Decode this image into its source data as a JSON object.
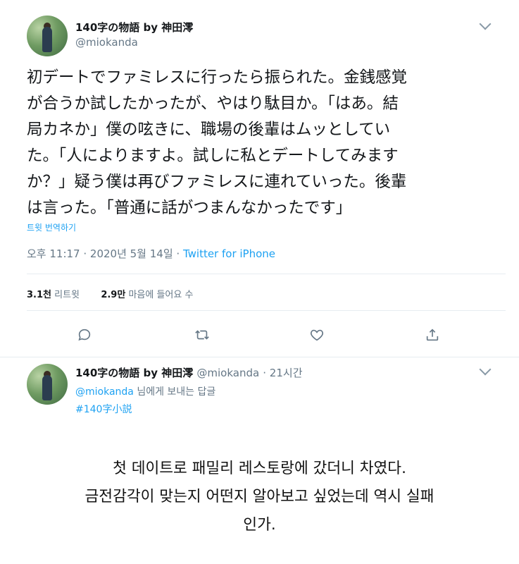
{
  "tweet": {
    "author_name": "140字の物語 by 神田澪",
    "author_handle": "@miokanda",
    "text_lines": [
      "初デートでファミレスに行ったら振られた。金銭感覚",
      "が合うか試したかったが、やはり駄目か。「はあ。結",
      "局カネか」僕の呟きに、職場の後輩はムッとしてい",
      "た。「人によりますよ。試しに私とデートしてみます",
      "か？」疑う僕は再びファミレスに連れていった。後輩",
      "は言った。「普通に話がつまんなかったです」"
    ],
    "translate_label": "트윗 번역하기",
    "time": "오후 11:17 · 2020년 5월 14일 · ",
    "source": "Twitter for iPhone",
    "retweets_count": "3.1천",
    "retweets_label": "리트윗",
    "likes_count": "2.9만",
    "likes_label": "마음에 들어요 수",
    "icons": [
      "chevron-down-icon",
      "reply-icon",
      "retweet-icon",
      "like-icon",
      "share-icon"
    ]
  },
  "reply": {
    "author_name": "140字の物語 by 神田澪",
    "author_handle": "@miokanda",
    "time": "· 21시간",
    "reply_to_handle": "@miokanda",
    "reply_to_suffix": " 님에게 보내는 답글",
    "hashtag": "#140字小説"
  },
  "caption": {
    "lines": [
      "첫 데이트로 패밀리 레스토랑에 갔더니 차였다.",
      "금전감각이 맞는지 어떤지 알아보고 싶었는데 역시 실패",
      "인가."
    ]
  },
  "colors": {
    "link": "#1da1f2",
    "secondary": "#657786",
    "text": "#14171a"
  }
}
